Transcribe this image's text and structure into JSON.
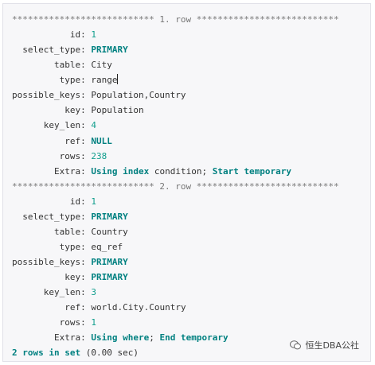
{
  "rows": [
    {
      "separator": "*************************** 1. row ***************************"
    },
    {
      "pad": "           ",
      "key": "id",
      "parts": [
        {
          "t": "1",
          "c": "num"
        }
      ]
    },
    {
      "pad": "  ",
      "key": "select_type",
      "parts": [
        {
          "t": "PRIMARY",
          "c": "kw"
        }
      ]
    },
    {
      "pad": "        ",
      "key": "table",
      "parts": [
        {
          "t": "City",
          "c": "str"
        }
      ]
    },
    {
      "pad": "         ",
      "key": "type",
      "parts": [
        {
          "t": "range",
          "c": "str"
        }
      ],
      "cursor": true
    },
    {
      "pad": "",
      "key": "possible_keys",
      "parts": [
        {
          "t": "Population,Country",
          "c": "str"
        }
      ]
    },
    {
      "pad": "          ",
      "key": "key",
      "parts": [
        {
          "t": "Population",
          "c": "str"
        }
      ]
    },
    {
      "pad": "      ",
      "key": "key_len",
      "parts": [
        {
          "t": "4",
          "c": "num"
        }
      ]
    },
    {
      "pad": "          ",
      "key": "ref",
      "parts": [
        {
          "t": "NULL",
          "c": "kw"
        }
      ]
    },
    {
      "pad": "         ",
      "key": "rows",
      "parts": [
        {
          "t": "238",
          "c": "num"
        }
      ]
    },
    {
      "pad": "        ",
      "key": "Extra",
      "parts": [
        {
          "t": "Using index",
          "c": "kw"
        },
        {
          "t": " condition; ",
          "c": "str"
        },
        {
          "t": "Start temporary",
          "c": "kw"
        }
      ]
    },
    {
      "separator": "*************************** 2. row ***************************"
    },
    {
      "pad": "           ",
      "key": "id",
      "parts": [
        {
          "t": "1",
          "c": "num"
        }
      ]
    },
    {
      "pad": "  ",
      "key": "select_type",
      "parts": [
        {
          "t": "PRIMARY",
          "c": "kw"
        }
      ]
    },
    {
      "pad": "        ",
      "key": "table",
      "parts": [
        {
          "t": "Country",
          "c": "str"
        }
      ]
    },
    {
      "pad": "         ",
      "key": "type",
      "parts": [
        {
          "t": "eq_ref",
          "c": "str"
        }
      ]
    },
    {
      "pad": "",
      "key": "possible_keys",
      "parts": [
        {
          "t": "PRIMARY",
          "c": "kw"
        }
      ]
    },
    {
      "pad": "          ",
      "key": "key",
      "parts": [
        {
          "t": "PRIMARY",
          "c": "kw"
        }
      ]
    },
    {
      "pad": "      ",
      "key": "key_len",
      "parts": [
        {
          "t": "3",
          "c": "num"
        }
      ]
    },
    {
      "pad": "          ",
      "key": "ref",
      "parts": [
        {
          "t": "world.City.Country",
          "c": "str"
        }
      ]
    },
    {
      "pad": "         ",
      "key": "rows",
      "parts": [
        {
          "t": "1",
          "c": "num"
        }
      ]
    },
    {
      "pad": "        ",
      "key": "Extra",
      "parts": [
        {
          "t": "Using where",
          "c": "kw"
        },
        {
          "t": "; ",
          "c": "str"
        },
        {
          "t": "End temporary",
          "c": "kw"
        }
      ]
    },
    {
      "footer": [
        {
          "t": "2 rows in set",
          "c": "kw"
        },
        {
          "t": " (0.00 sec)",
          "c": "str"
        }
      ]
    }
  ],
  "watermark": {
    "text": "恒生DBA公社",
    "icon": "wechat-icon"
  }
}
